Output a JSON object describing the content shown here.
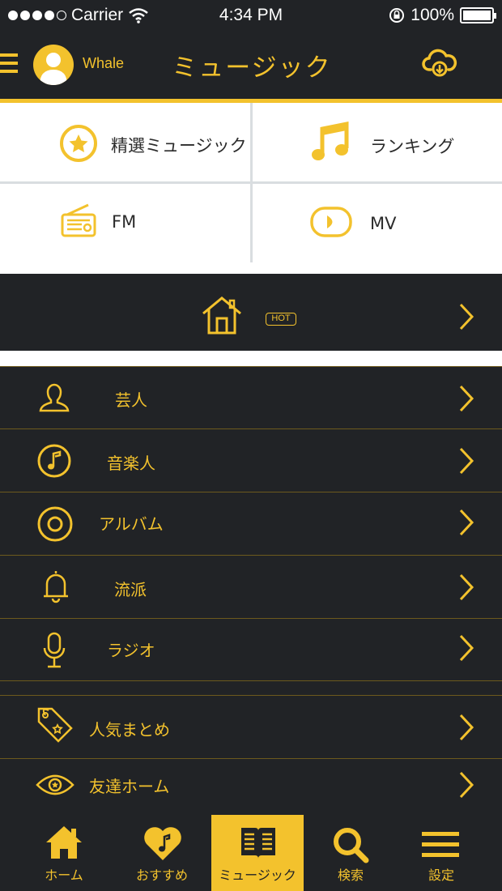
{
  "status_bar": {
    "carrier": "Carrier",
    "time": "4:34 PM",
    "battery": "100%"
  },
  "header": {
    "username": "Whale",
    "title": "ミュージック"
  },
  "grid": [
    {
      "label": "精選ミュージック",
      "icon": "star-circle-icon"
    },
    {
      "label": "ランキング",
      "icon": "music-note-icon"
    },
    {
      "label": "FM",
      "icon": "radio-icon"
    },
    {
      "label": "MV",
      "icon": "video-play-icon"
    }
  ],
  "hot_banner": {
    "badge": "HOT",
    "icon": "house-icon"
  },
  "list": [
    {
      "label": "芸人",
      "icon": "person-icon"
    },
    {
      "label": "音楽人",
      "icon": "music-circle-icon"
    },
    {
      "label": "アルバム",
      "icon": "disc-icon"
    },
    {
      "label": "流派",
      "icon": "bell-icon"
    },
    {
      "label": "ラジオ",
      "icon": "microphone-icon"
    },
    {
      "label": "人気まとめ",
      "icon": "tag-icon"
    },
    {
      "label": "友達ホーム",
      "icon": "eye-icon"
    }
  ],
  "tabs": [
    {
      "label": "ホーム",
      "icon": "home-icon"
    },
    {
      "label": "おすすめ",
      "icon": "heart-note-icon"
    },
    {
      "label": "ミュージック",
      "icon": "book-icon",
      "active": true
    },
    {
      "label": "検索",
      "icon": "search-icon"
    },
    {
      "label": "設定",
      "icon": "menu-icon"
    }
  ],
  "colors": {
    "accent": "#f3c22d",
    "dark": "#212326",
    "divider": "#6d5a1d",
    "light_divider": "#d9dde0"
  }
}
